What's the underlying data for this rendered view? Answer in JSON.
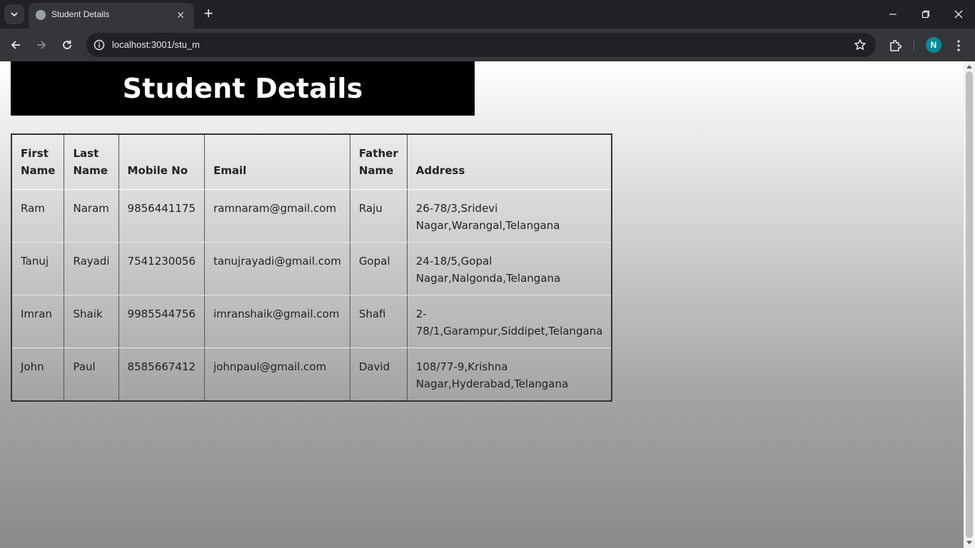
{
  "browser": {
    "tab_title": "Student Details",
    "tab_close": "✕",
    "new_tab": "+",
    "url": "localhost:3001/stu_m",
    "profile_initial": "N"
  },
  "page": {
    "heading": "Student Details"
  },
  "table": {
    "headers": {
      "first_name": "First Name",
      "last_name": "Last Name",
      "mobile": "Mobile No",
      "email": "Email",
      "father_name": "Father Name",
      "address": "Address"
    },
    "rows": [
      {
        "first_name": "Ram",
        "last_name": "Naram",
        "mobile": "9856441175",
        "email": "ramnaram@gmail.com",
        "father_name": "Raju",
        "address": "26-78/3,Sridevi Nagar,Warangal,Telangana"
      },
      {
        "first_name": "Tanuj",
        "last_name": "Rayadi",
        "mobile": "7541230056",
        "email": "tanujrayadi@gmail.com",
        "father_name": "Gopal",
        "address": "24-18/5,Gopal Nagar,Nalgonda,Telangana"
      },
      {
        "first_name": "Imran",
        "last_name": "Shaik",
        "mobile": "9985544756",
        "email": "imranshaik@gmail.com",
        "father_name": "Shafi",
        "address": "2-78/1,Garampur,Siddipet,Telangana"
      },
      {
        "first_name": "John",
        "last_name": "Paul",
        "mobile": "8585667412",
        "email": "johnpaul@gmail.com",
        "father_name": "David",
        "address": "108/77-9,Krishna Nagar,Hyderabad,Telangana"
      }
    ]
  }
}
